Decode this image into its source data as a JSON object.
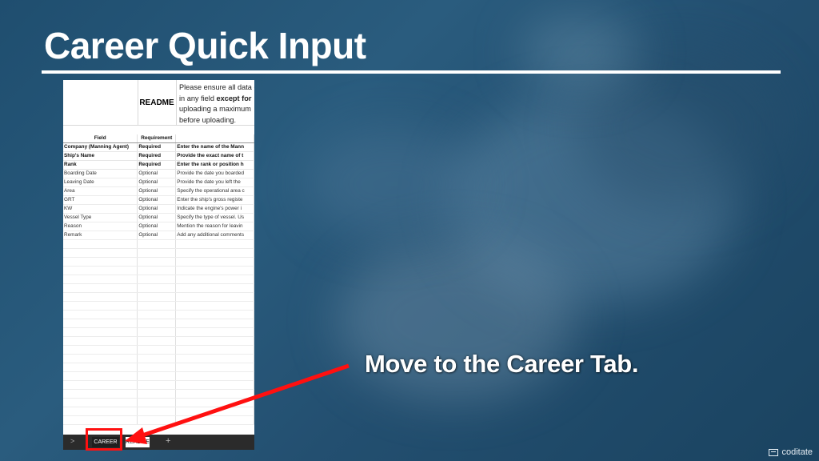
{
  "slide": {
    "title": "Career Quick Input",
    "callout": "Move to the Career Tab.",
    "brand": "coditate"
  },
  "sheet": {
    "readme_label": "README",
    "readme_lines": [
      {
        "pre": "Please ensure all data e",
        "bold": "",
        "post": ""
      },
      {
        "pre": "in any field ",
        "bold": "except for",
        "post": ""
      },
      {
        "pre": "uploading a maximum",
        "bold": "",
        "post": ""
      },
      {
        "pre": "before uploading.",
        "bold": "",
        "post": ""
      }
    ],
    "headers": [
      "Field",
      "Requirement",
      ""
    ],
    "rows": [
      {
        "field": "Company (Manning Agent)",
        "req": "Required",
        "desc": "Enter the name of the Mann",
        "bold": true
      },
      {
        "field": "Ship's Name",
        "req": "Required",
        "desc": "Provide the exact name of t",
        "bold": true
      },
      {
        "field": "Rank",
        "req": "Required",
        "desc": "Enter the rank or position h",
        "bold": true
      },
      {
        "field": "Boarding Date",
        "req": "Optional",
        "desc": "Provide the date you boarded",
        "bold": false
      },
      {
        "field": "Leaving Date",
        "req": "Optional",
        "desc": "Provide the date you left the",
        "bold": false
      },
      {
        "field": "Area",
        "req": "Optional",
        "desc": "Specify the operational area c",
        "bold": false
      },
      {
        "field": "GRT",
        "req": "Optional",
        "desc": "Enter the ship's gross registe",
        "bold": false
      },
      {
        "field": "KW",
        "req": "Optional",
        "desc": "Indicate the engine's power i",
        "bold": false
      },
      {
        "field": "Vessel Type",
        "req": "Optional",
        "desc": "Specify the type of vessel. Us",
        "bold": false
      },
      {
        "field": "Reason",
        "req": "Optional",
        "desc": "Mention the reason for leavin",
        "bold": false
      },
      {
        "field": "Remark",
        "req": "Optional",
        "desc": "Add any additional comments",
        "bold": false
      }
    ],
    "tabs": {
      "nav": ">",
      "career": "CAREER",
      "readme": "README",
      "add": "+"
    }
  },
  "colors": {
    "highlight": "#ff1010",
    "arrow": "#ff1010",
    "background": "#234f70"
  },
  "icons": [
    "chevron-right-icon",
    "plus-icon",
    "monitor-icon"
  ]
}
